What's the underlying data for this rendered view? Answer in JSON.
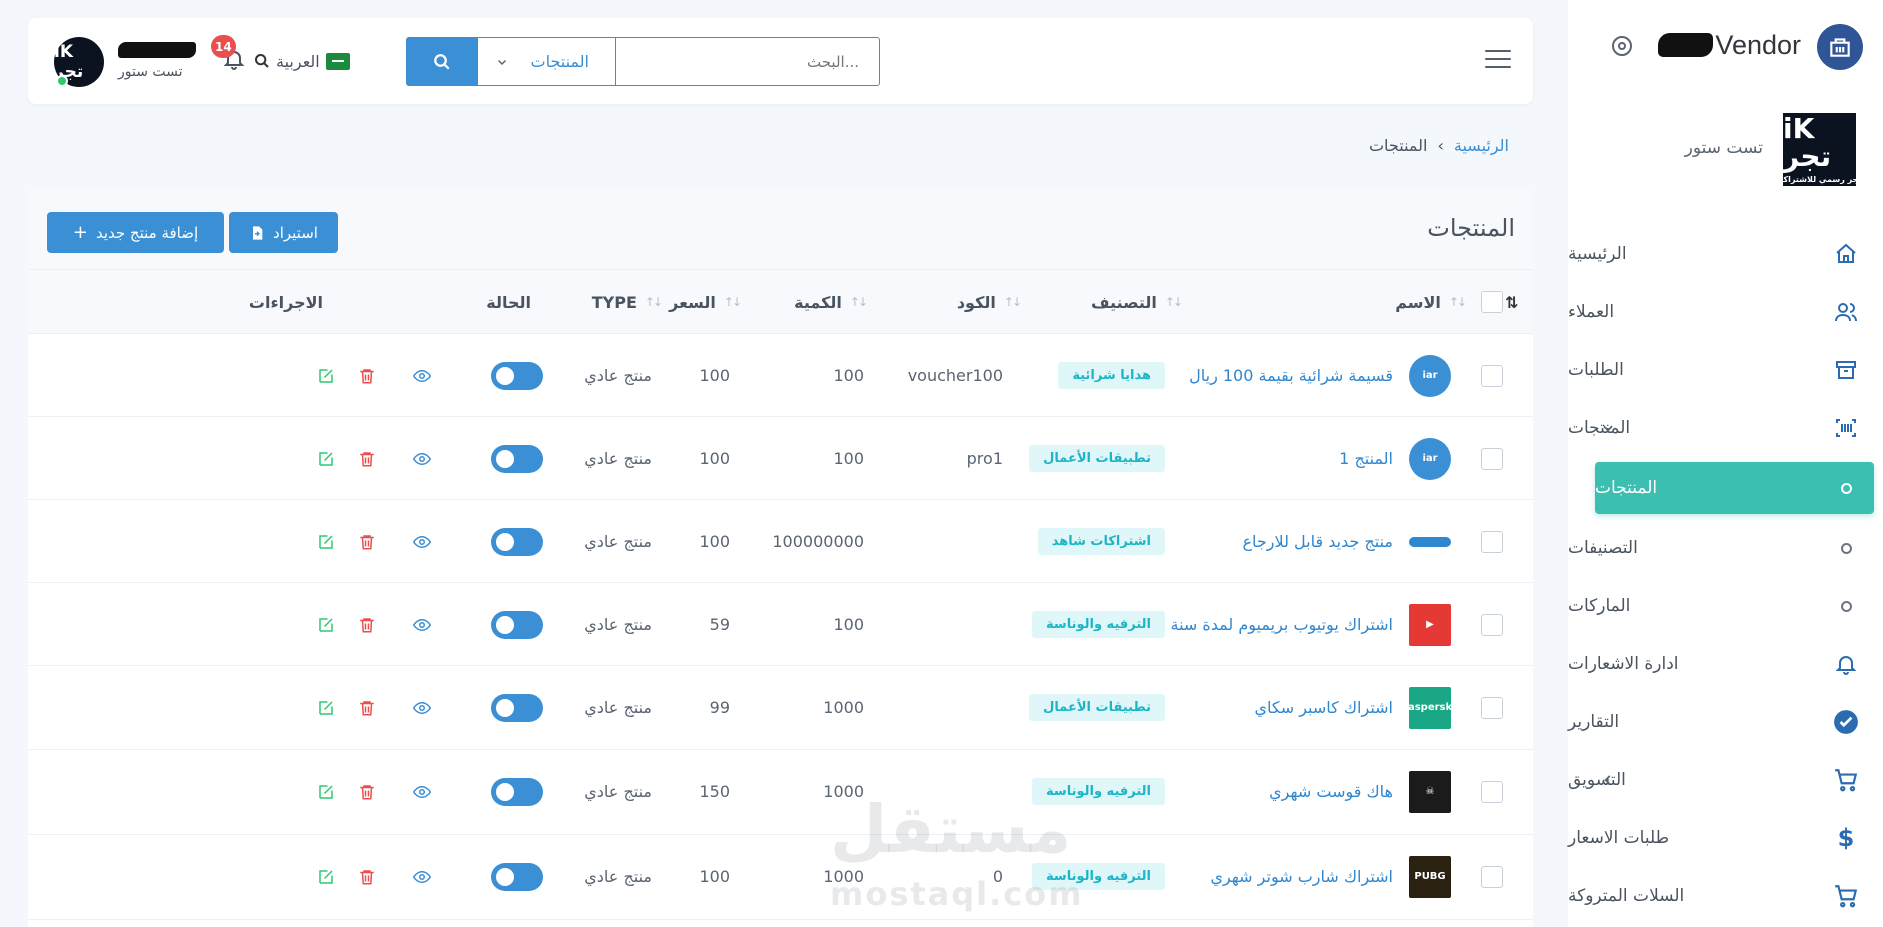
{
  "sidebar": {
    "brand_name": "Vendor",
    "store_logo_big": "iK تجر",
    "store_logo_small": "متجر رسمي للاشتراكات",
    "store_name": "تست ستور",
    "items": [
      {
        "label": "الرئيسية",
        "icon": "home-icon"
      },
      {
        "label": "العملاء",
        "icon": "users-icon"
      },
      {
        "label": "الطلبات",
        "icon": "archive-box-icon"
      },
      {
        "label": "المنتجات",
        "icon": "barcode-icon"
      },
      {
        "label": "المنتجات",
        "icon": "circle-dot-icon",
        "active": true
      },
      {
        "label": "التصنيفات",
        "icon": "circle-dot-icon"
      },
      {
        "label": "الماركات",
        "icon": "circle-dot-icon"
      },
      {
        "label": "ادارة الاشعارات",
        "icon": "bell-icon"
      },
      {
        "label": "التقارير",
        "icon": "check-circle-icon"
      },
      {
        "label": "التسويق",
        "icon": "cart-icon"
      },
      {
        "label": "طلبات الاسعار",
        "icon": "dollar-icon"
      },
      {
        "label": "السلات المتروكة",
        "icon": "cart-icon"
      }
    ]
  },
  "topbar": {
    "search_placeholder": "البحث...",
    "search_scope": "المنتجات",
    "language": "العربية",
    "notification_count": "14",
    "user_store": "تست ستور",
    "avatar_text": "iK تجر"
  },
  "breadcrumb": {
    "home": "الرئيسية",
    "current": "المنتجات"
  },
  "page": {
    "title": "المنتجات",
    "import_button": "استيراد",
    "add_button": "إضافة منتج جديد"
  },
  "table": {
    "columns": {
      "name": "الاسم",
      "category": "التصنيف",
      "code": "الكود",
      "quantity": "الكمية",
      "price": "السعر",
      "type": "TYPE",
      "status": "الحالة",
      "actions": "الاجراءات"
    },
    "rows": [
      {
        "name": "قسيمة شرائية بقيمة 100 ريال",
        "category": "هدايا شرائية",
        "code": "voucher100",
        "quantity": "100",
        "price": "100",
        "type": "منتج عادي",
        "thumb_color": "#3a8fd5",
        "thumb_text": "iar"
      },
      {
        "name": "المنتج 1",
        "category": "تطبيقات الأعمال",
        "code": "pro1",
        "quantity": "100",
        "price": "100",
        "type": "منتج عادي",
        "thumb_color": "#3a8fd5",
        "thumb_text": "iar"
      },
      {
        "name": "منتج جديد قابل للارجاع",
        "category": "اشتراكات شاهد",
        "code": "",
        "quantity": "100000000",
        "price": "100",
        "type": "منتج عادي",
        "thumb_color": "#2f87d0",
        "thumb_text": ""
      },
      {
        "name": "اشتراك يوتيوب بريميوم لمدة سنة",
        "category": "الترفيه والوناسة",
        "code": "",
        "quantity": "100",
        "price": "59",
        "type": "منتج عادي",
        "thumb_color": "#e53935",
        "thumb_text": "▶"
      },
      {
        "name": "اشتراك كاسبر سكاي",
        "category": "تطبيقات الأعمال",
        "code": "",
        "quantity": "1000",
        "price": "99",
        "type": "منتج عادي",
        "thumb_color": "#1aa785",
        "thumb_text": "kaspersky"
      },
      {
        "name": "هاك قوست شهري",
        "category": "الترفيه والوناسة",
        "code": "",
        "quantity": "1000",
        "price": "150",
        "type": "منتج عادي",
        "thumb_color": "#1b1b1b",
        "thumb_text": "☠"
      },
      {
        "name": "اشتراك شارب شوتر شهري",
        "category": "الترفيه والوناسة",
        "code": "0",
        "quantity": "1000",
        "price": "100",
        "type": "منتج عادي",
        "thumb_color": "#2a2110",
        "thumb_text": "PUBG"
      }
    ]
  },
  "watermark": {
    "arabic": "مستقل",
    "latin": "mostaql.com"
  },
  "colors": {
    "primary": "#3a8fd5",
    "active_nav": "#3cbfb0",
    "badge_bg": "#e0f7f9",
    "badge_text": "#1cb5c7",
    "delete": "#e94f4f",
    "edit": "#2ec971"
  }
}
